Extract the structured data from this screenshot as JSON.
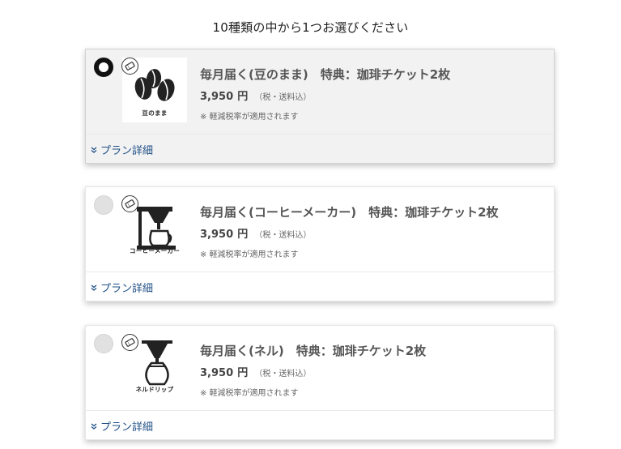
{
  "heading": "10種類の中から1つお選びください",
  "plans": [
    {
      "title": "毎月届く(豆のまま)　特典：珈琲チケット2枚",
      "price": "3,950",
      "price_unit": "円",
      "tax_note": "（税・送料込）",
      "reduced_tax_note": "※ 軽減税率が適用されます",
      "image_label": "豆のまま",
      "details_label": "プラン詳細",
      "selected": true
    },
    {
      "title": "毎月届く(コーヒーメーカー)　特典：珈琲チケット2枚",
      "price": "3,950",
      "price_unit": "円",
      "tax_note": "（税・送料込）",
      "reduced_tax_note": "※ 軽減税率が適用されます",
      "image_label": "コーヒーメーカー",
      "details_label": "プラン詳細",
      "selected": false
    },
    {
      "title": "毎月届く(ネル)　特典：珈琲チケット2枚",
      "price": "3,950",
      "price_unit": "円",
      "tax_note": "（税・送料込）",
      "reduced_tax_note": "※ 軽減税率が適用されます",
      "image_label": "ネルドリップ",
      "details_label": "プラン詳細",
      "selected": false
    }
  ],
  "icons": {
    "badge": "ticket-icon",
    "details": "chevron-down-icon"
  },
  "colors": {
    "link": "#1f4f86",
    "selected_card_bg": "#f2f2f2",
    "radio_checked": "#111111",
    "radio_unchecked": "#e1e1e1"
  }
}
